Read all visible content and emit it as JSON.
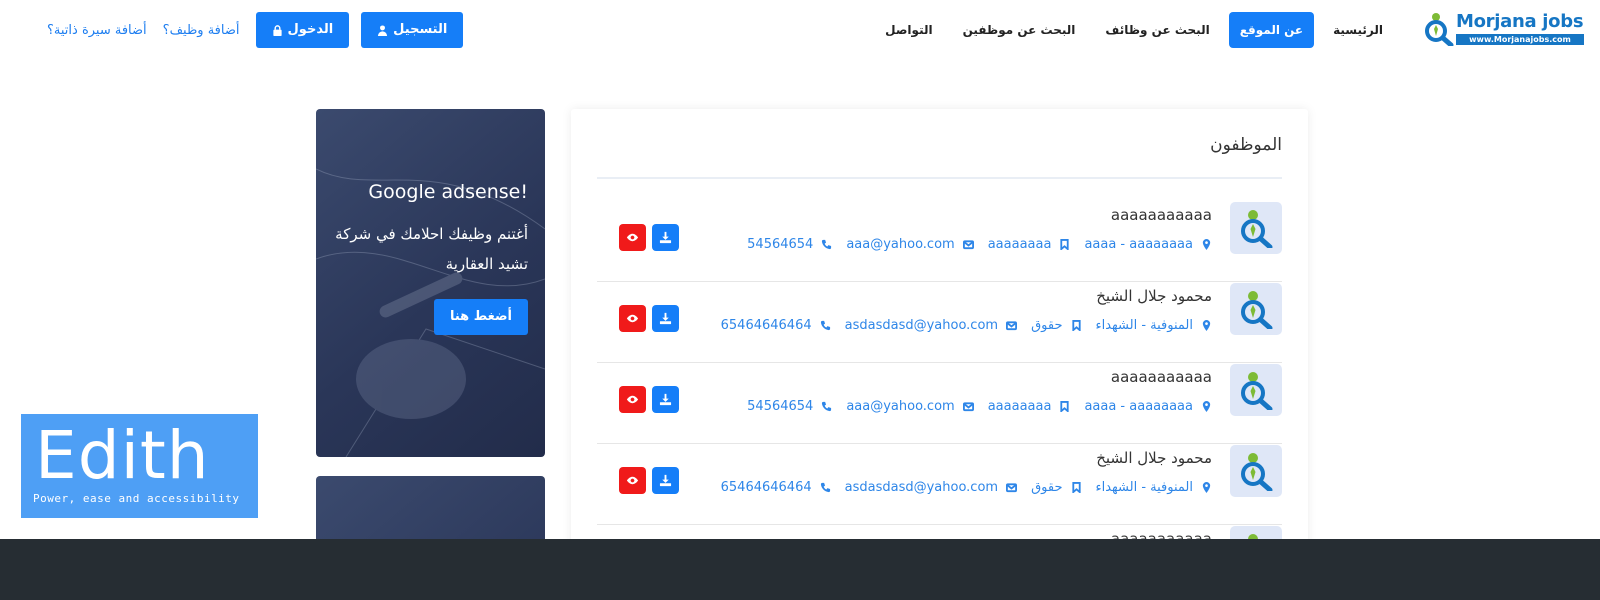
{
  "brand": {
    "name": "Morjana jobs",
    "subtitle": "www.Morjanajobs.com"
  },
  "nav": [
    {
      "label": "الرئيسية",
      "active": false
    },
    {
      "label": "عن الموقع",
      "active": true
    },
    {
      "label": "البحث عن وظائف",
      "active": false
    },
    {
      "label": "البحث عن موظفين",
      "active": false
    },
    {
      "label": "التواصل",
      "active": false
    }
  ],
  "auth": {
    "register": "التسجيل",
    "login": "الدخول",
    "add_job": "أضافة وظيف؟",
    "add_cv": "أضافة سيرة ذاتية؟"
  },
  "employees": {
    "title": "الموظفون",
    "rows": [
      {
        "name": "aaaaaaaaaaa",
        "location": "aaaa - aaaaaaaa",
        "field": "aaaaaaaa",
        "email": "aaa@yahoo.com",
        "phone": "54564654"
      },
      {
        "name": "محمود جلال الشيخ",
        "location": "المنوفية - الشهداء",
        "field": "حقوق",
        "email": "asdasdasd@yahoo.com",
        "phone": "65464646464"
      },
      {
        "name": "aaaaaaaaaaa",
        "location": "aaaa - aaaaaaaa",
        "field": "aaaaaaaa",
        "email": "aaa@yahoo.com",
        "phone": "54564654"
      },
      {
        "name": "محمود جلال الشيخ",
        "location": "المنوفية - الشهداء",
        "field": "حقوق",
        "email": "asdasdasd@yahoo.com",
        "phone": "65464646464"
      },
      {
        "name": "aaaaaaaaaaa",
        "location": "",
        "field": "",
        "email": "",
        "phone": ""
      }
    ]
  },
  "ad": {
    "title": "Google adsense!",
    "text": "أغتنم وظيفك احلامك في شركة تشيد العقارية",
    "button": "أضغط هنا"
  },
  "edith": {
    "title": "Edith",
    "subtitle": "Power, ease and accessibility"
  },
  "colors": {
    "primary": "#157ef8",
    "danger": "#f01a1a",
    "link": "#2e86e8",
    "footer": "#262d33",
    "edith": "#4e9ff5"
  }
}
